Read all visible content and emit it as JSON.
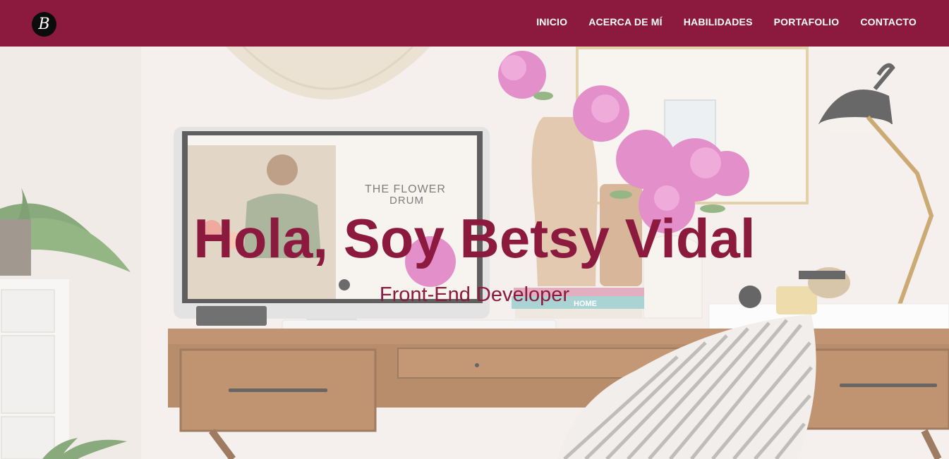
{
  "logo": {
    "letter": "B"
  },
  "nav": {
    "items": [
      {
        "label": "INICIO"
      },
      {
        "label": "ACERCA DE MÍ"
      },
      {
        "label": "HABILIDADES"
      },
      {
        "label": "PORTAFOLIO"
      },
      {
        "label": "CONTACTO"
      }
    ]
  },
  "hero": {
    "title": "Hola, Soy Betsy Vidal",
    "subtitle": "Front-End Developer",
    "screen_text": "THE FLOWER\nDRUM",
    "book_text": "HOME"
  },
  "colors": {
    "brand": "#8c1a3f",
    "nav_text": "#ffffff",
    "logo_bg": "#0c0c0c"
  }
}
